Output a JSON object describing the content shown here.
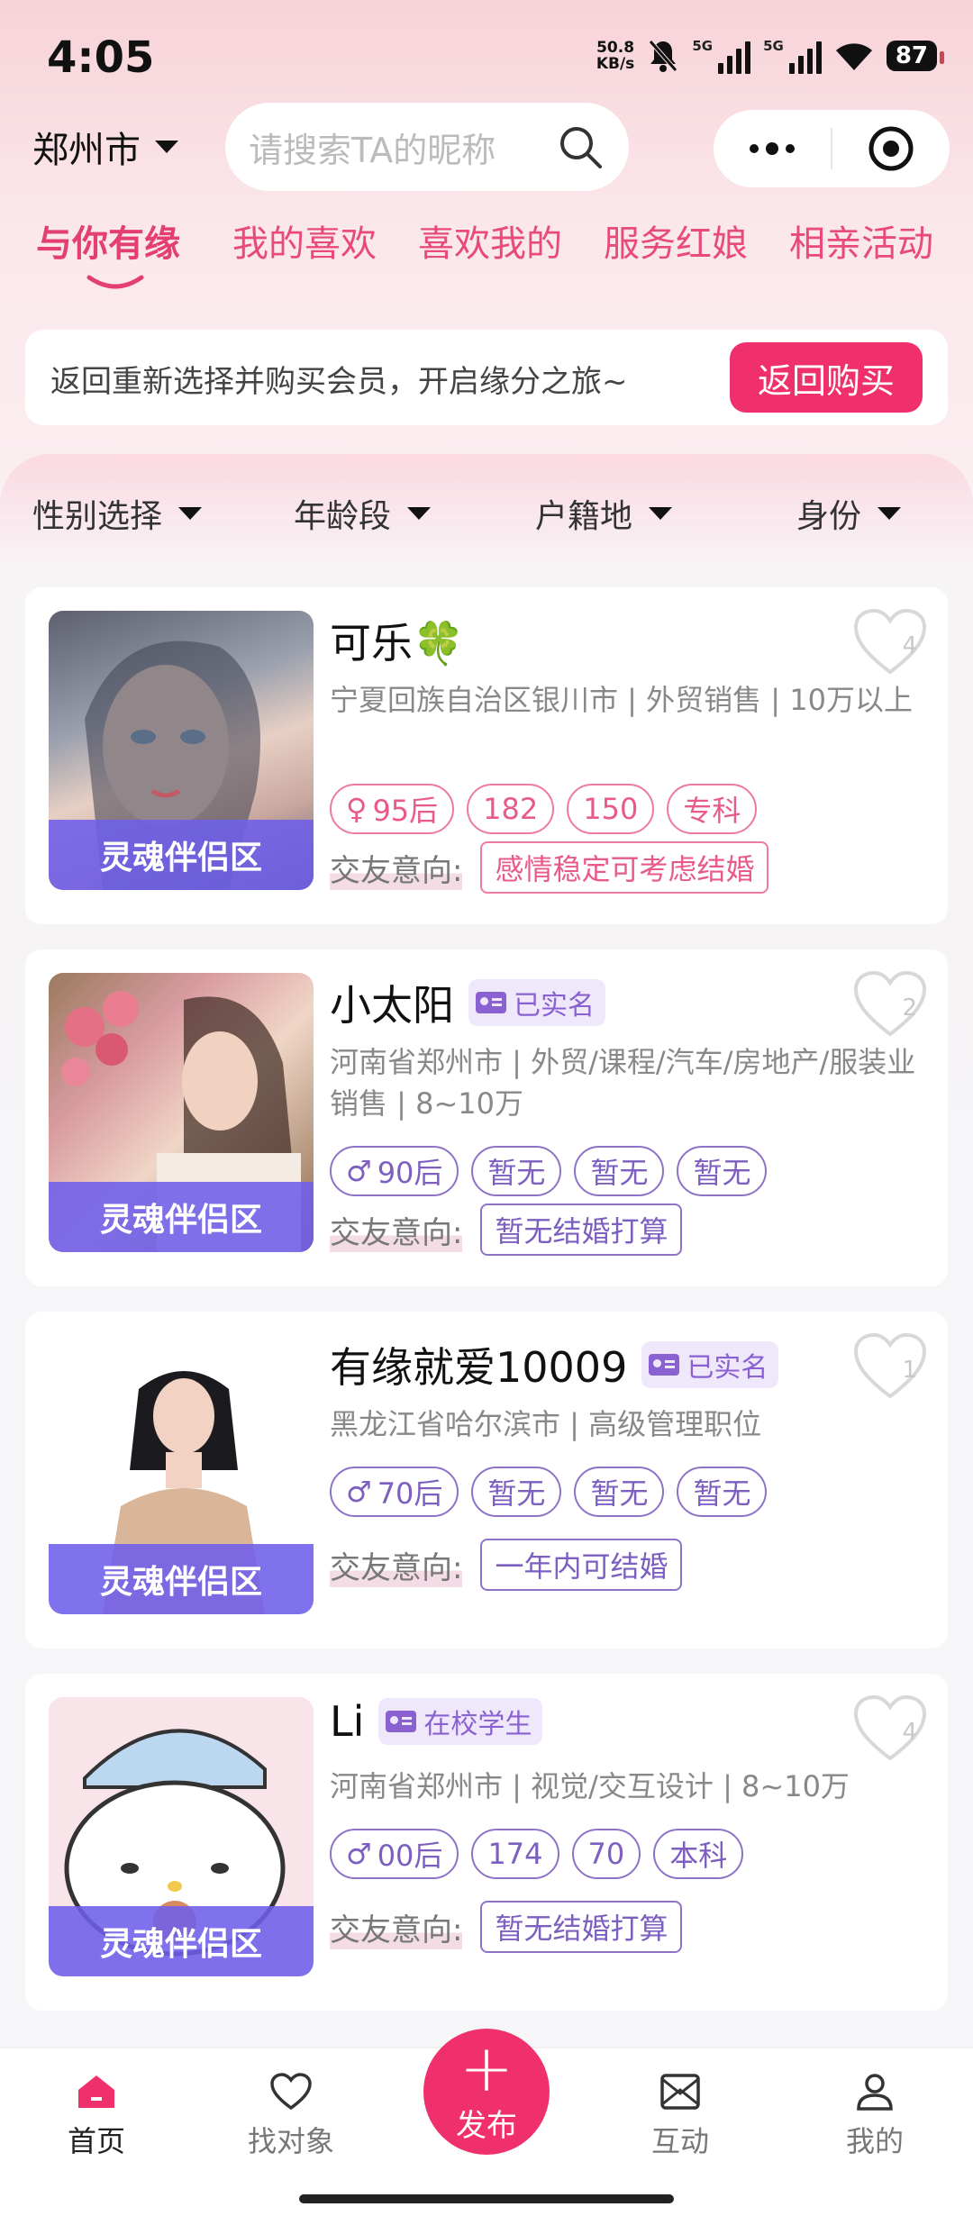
{
  "status": {
    "time": "4:05",
    "net_speed_top": "50.8",
    "net_speed_bottom": "KB/s",
    "sim1": "5G",
    "sim2": "5G",
    "battery": "87"
  },
  "header": {
    "city": "郑州市",
    "search_placeholder": "请搜索TA的昵称"
  },
  "tabs": [
    "与你有缘",
    "我的喜欢",
    "喜欢我的",
    "服务红娘",
    "相亲活动"
  ],
  "notice": {
    "text": "返回重新选择并购买会员，开启缘分之旅~",
    "button": "返回购买"
  },
  "filters": [
    "性别选择",
    "年龄段",
    "户籍地",
    "身份"
  ],
  "intent_label": "交友意向:",
  "cards": [
    {
      "name": "可乐🍀",
      "badge": "",
      "desc": "宁夏回族自治区银川市 | 外贸销售 | 10万以上",
      "tags": [
        "95后",
        "182",
        "150",
        "专科"
      ],
      "gender": "female",
      "intent": "感情稳定可考虑结婚",
      "likes": "4",
      "zone": "灵魂伴侣区",
      "theme": "pink"
    },
    {
      "name": "小太阳",
      "badge": "已实名",
      "desc": "河南省郑州市 | 外贸/课程/汽车/房地产/服装业销售 | 8~10万",
      "tags": [
        "90后",
        "暂无",
        "暂无",
        "暂无"
      ],
      "gender": "male",
      "intent": "暂无结婚打算",
      "likes": "2",
      "zone": "灵魂伴侣区",
      "theme": "purple"
    },
    {
      "name": "有缘就爱10009",
      "badge": "已实名",
      "desc": "黑龙江省哈尔滨市 | 高级管理职位",
      "tags": [
        "70后",
        "暂无",
        "暂无",
        "暂无"
      ],
      "gender": "male",
      "intent": "一年内可结婚",
      "likes": "1",
      "zone": "灵魂伴侣区",
      "theme": "purple"
    },
    {
      "name": "Li",
      "badge": "在校学生",
      "desc": "河南省郑州市 | 视觉/交互设计 | 8~10万",
      "tags": [
        "00后",
        "174",
        "70",
        "本科"
      ],
      "gender": "male",
      "intent": "暂无结婚打算",
      "likes": "4",
      "zone": "灵魂伴侣区",
      "theme": "purple"
    }
  ],
  "nav": {
    "home": "首页",
    "find": "找对象",
    "publish": "发布",
    "interact": "互动",
    "mine": "我的"
  },
  "colors": {
    "accent": "#f0306c",
    "tab_text": "#e84a7c",
    "zone_bg": "#6e5feb",
    "tag_pink": "#e85a8a",
    "tag_purple": "#7d5fc0"
  }
}
